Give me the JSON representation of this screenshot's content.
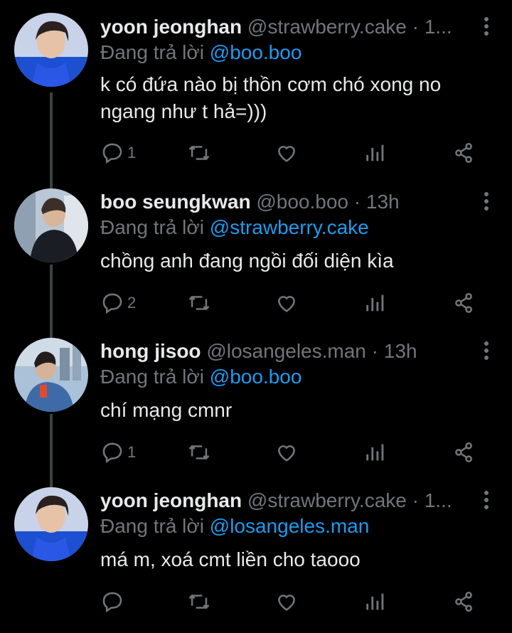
{
  "colors": {
    "background": "#000000",
    "text": "#e7e9ea",
    "muted": "#71767b",
    "link": "#1d9bf0"
  },
  "tweets": [
    {
      "name": "yoon jeonghan",
      "meta": "@strawberry.cake · 1...",
      "reply_prefix": "Đang trả lời",
      "reply_handle": "@boo.boo",
      "text": "k có đứa nào bị thồn cơm chó xong no ngang như t hả=)))",
      "reply_count": "1"
    },
    {
      "name": "boo seungkwan",
      "meta": "@boo.boo · 13h",
      "reply_prefix": "Đang trả lời",
      "reply_handle": "@strawberry.cake",
      "text": "chồng anh đang ngồi đối diện kìa",
      "reply_count": "2"
    },
    {
      "name": "hong jisoo",
      "meta": "@losangeles.man · 13h",
      "reply_prefix": "Đang trả lời",
      "reply_handle": "@boo.boo",
      "text": "chí mạng cmnr",
      "reply_count": "1"
    },
    {
      "name": "yoon jeonghan",
      "meta": "@strawberry.cake · 1...",
      "reply_prefix": "Đang trả lời",
      "reply_handle": "@losangeles.man",
      "text": "má m, xoá cmt liền cho taooo",
      "reply_count": ""
    }
  ],
  "icons": [
    "reply-icon",
    "retweet-icon",
    "like-icon",
    "analytics-icon",
    "share-icon",
    "more-icon"
  ]
}
